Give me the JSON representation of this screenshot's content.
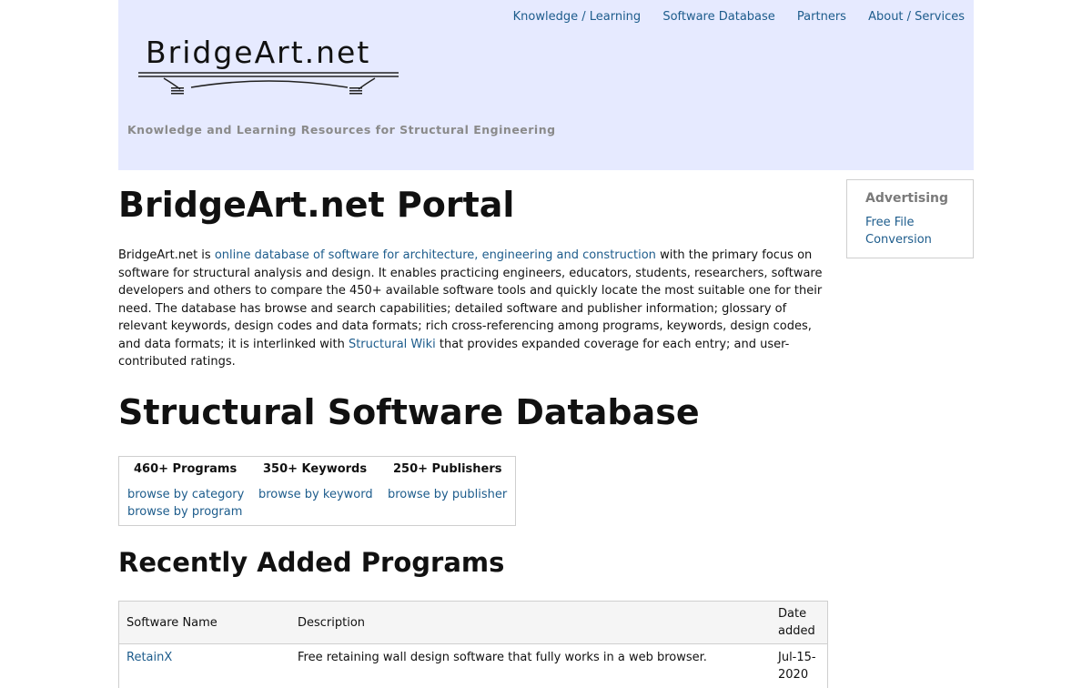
{
  "nav": {
    "items": [
      "Knowledge / Learning",
      "Software Database",
      "Partners",
      "About / Services"
    ]
  },
  "logo": {
    "text": "BridgeArt.net"
  },
  "tagline": "Knowledge and Learning Resources for Structural Engineering",
  "page_title": "BridgeArt.net Portal",
  "intro": {
    "before_link1": "BridgeArt.net is ",
    "link1": "online database of software for architecture, engineering and construction",
    "middle": " with the primary focus on software for structural analysis and design. It enables practicing engineers, educators, students, researchers, software developers and others to compare the 450+ available software tools and quickly locate the most suitable one for their need. The database has browse and search capabilities; detailed software and publisher information; glossary of relevant keywords, design codes and data formats; rich cross-referencing among programs, keywords, design codes, and data formats; it is interlinked with ",
    "link2": "Structural Wiki",
    "after_link2": " that provides expanded coverage for each entry; and user-contributed ratings."
  },
  "database_heading": "Structural Software Database",
  "stats": {
    "programs": {
      "count": "460+ Programs",
      "link1": "browse by category",
      "link2": "browse by program"
    },
    "keywords": {
      "count": "350+ Keywords",
      "link1": "browse by keyword"
    },
    "publishers": {
      "count": "250+ Publishers",
      "link1": "browse by publisher"
    }
  },
  "recent_heading": "Recently Added Programs",
  "recent_table": {
    "headers": [
      "Software Name",
      "Description",
      "Date added"
    ],
    "rows": [
      {
        "name": "RetainX",
        "description": "Free retaining wall design software that fully works in a web browser.",
        "date": "Jul-15-2020"
      }
    ]
  },
  "sidebar": {
    "title": "Advertising",
    "link": "Free File Conversion"
  },
  "colors": {
    "header_bg": "#e6eaff",
    "link": "#1d5c8c",
    "tagline": "#8a8a8a"
  }
}
